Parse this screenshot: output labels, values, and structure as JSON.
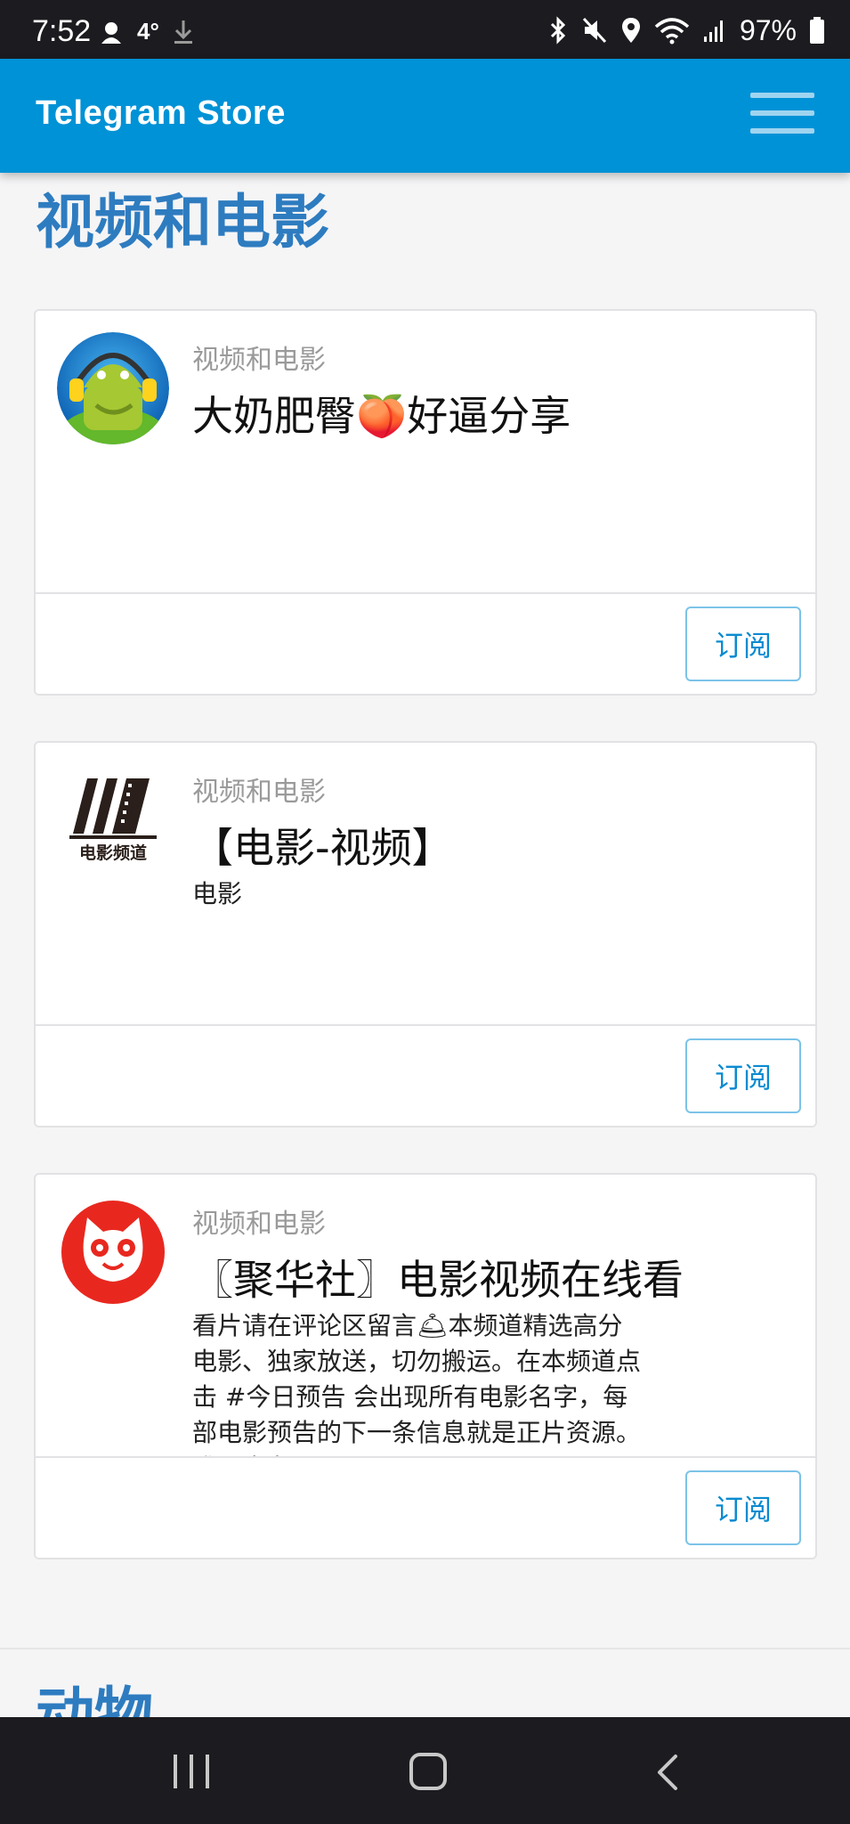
{
  "status_bar": {
    "time": "7:52",
    "temperature": "4°",
    "battery": "97%",
    "left_icons": [
      "notification-icon",
      "download-icon"
    ],
    "right_icons": [
      "bluetooth-icon",
      "mute-icon",
      "location-icon",
      "wifi-icon",
      "signal-icon",
      "battery-icon"
    ]
  },
  "header": {
    "brand": "Telegram Store",
    "menu_icon": "hamburger-menu-icon"
  },
  "section": {
    "title": "视频和电影"
  },
  "cards": [
    {
      "category": "视频和电影",
      "title": "大奶肥臀🍑好逼分享",
      "description": "",
      "subscribe_label": "订阅",
      "avatar_icon": "android-headphones-avatar"
    },
    {
      "category": "视频和电影",
      "title": "【电影-视频】",
      "description": "电影",
      "subscribe_label": "订阅",
      "avatar_icon": "film-channel-logo",
      "avatar_text": "电影频道"
    },
    {
      "category": "视频和电影",
      "title": "〖聚华社〗电影视频在线看",
      "description": "看片请在评论区留言🛎本频道精选高分电影、独家放送，切勿搬运。在本频道点击 #今日预告 会出现所有电影名字，每部电影预告的下一条信息就是正片资源。唯一商务： @chenergou",
      "subscribe_label": "订阅",
      "avatar_icon": "cat-face-logo"
    }
  ],
  "next_section": {
    "title": "动物"
  },
  "nav_bar": {
    "icons": [
      "recent-apps-icon",
      "home-icon",
      "back-icon"
    ]
  }
}
